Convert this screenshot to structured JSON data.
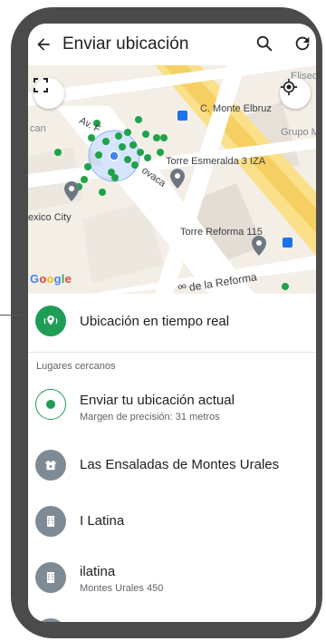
{
  "appbar": {
    "title": "Enviar ubicación",
    "back_icon": "arrow-back-icon",
    "search_icon": "search-icon",
    "refresh_icon": "refresh-icon"
  },
  "map": {
    "labels": {
      "monte_elbruz": "C. Monte Elbruz",
      "torre_esmeralda": "Torre Esmeralda 3 IZA",
      "torre_reforma": "Torre Reforma 115",
      "mexico_city": "exico City",
      "paseo_reforma": "ºº de la Reforma",
      "av": "Av. F",
      "vaca": "ovaca",
      "elisee": "Eliseo",
      "grupo": "Grupo M",
      "cam": "can"
    },
    "google": "Google",
    "colors": {
      "accent": "#1f9d55",
      "road_major": "#fbe08a",
      "map_bg": "#f3efe7",
      "dot": "#1fa24a",
      "user_dot": "#4285f4"
    }
  },
  "live_location": {
    "label": "Ubicación en tiempo real"
  },
  "nearby_section": "Lugares cercanos",
  "places": [
    {
      "name": "Enviar tu ubicación actual",
      "detail": "Margen de precisión: 31 metros",
      "icon": "current-location-icon"
    },
    {
      "name": "Las Ensaladas de Montes Urales",
      "detail": "",
      "icon": "restaurant-icon"
    },
    {
      "name": "I Latina",
      "detail": "",
      "icon": "building-icon"
    },
    {
      "name": "ilatina",
      "detail": "Montes Urales 450",
      "icon": "building-icon"
    }
  ]
}
